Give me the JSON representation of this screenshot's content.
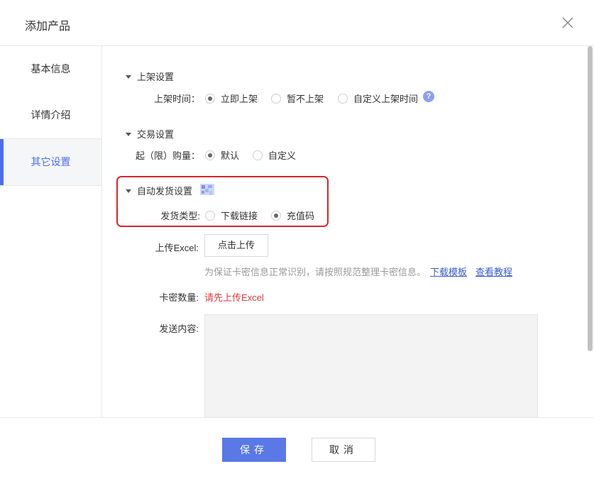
{
  "dialog": {
    "title": "添加产品"
  },
  "sidebar": {
    "items": [
      {
        "label": "基本信息",
        "active": false
      },
      {
        "label": "详情介绍",
        "active": false
      },
      {
        "label": "其它设置",
        "active": true
      }
    ]
  },
  "listing": {
    "section_title": "上架设置",
    "time_label": "上架时间：",
    "options": [
      "立即上架",
      "暂不上架",
      "自定义上架时间"
    ],
    "selected": "立即上架",
    "help_glyph": "?"
  },
  "trade": {
    "section_title": "交易设置",
    "quantity_label": "起（限）购量：",
    "options": [
      "默认",
      "自定义"
    ],
    "selected": "默认"
  },
  "auto_ship": {
    "section_title": "自动发货设置",
    "type_label": "发货类型:",
    "options": [
      "下载链接",
      "充值码"
    ],
    "selected": "充值码",
    "upload_label": "上传Excel:",
    "upload_button": "点击上传",
    "hint_text": "为保证卡密信息正常识别，请按照规范整理卡密信息。",
    "download_template_link": "下载模板",
    "tutorial_link": "查看教程",
    "card_count_label": "卡密数量:",
    "card_count_value": "请先上传Excel",
    "content_label": "发送内容:",
    "content_value": ""
  },
  "footer": {
    "save_label": "保存",
    "cancel_label": "取消"
  },
  "colors": {
    "accent": "#5a78e6",
    "highlight": "#d7262b",
    "error": "#e0393e",
    "link": "#3b5bcc"
  },
  "icons": {
    "close": "close-icon",
    "caret": "caret-down-icon",
    "help": "help-icon",
    "qr": "qr-code-icon"
  }
}
